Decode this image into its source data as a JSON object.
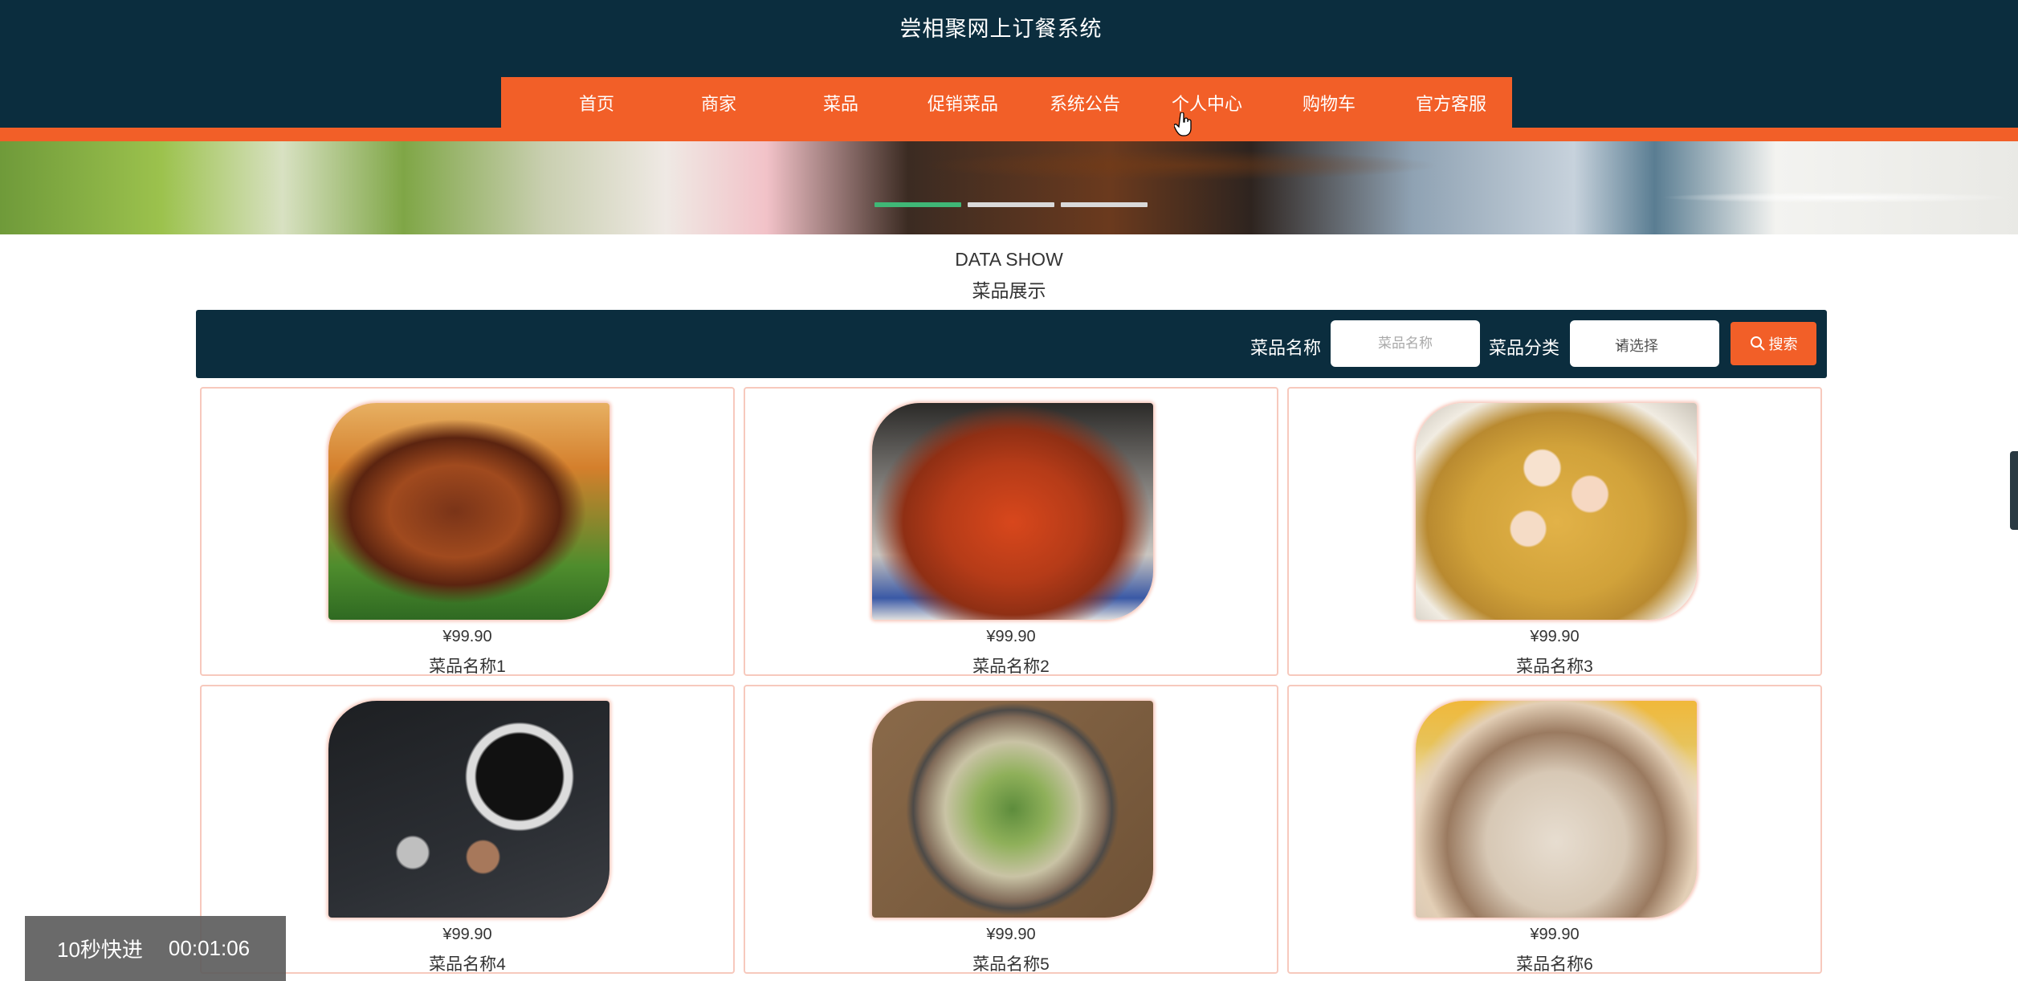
{
  "site": {
    "title": "尝相聚网上订餐系统"
  },
  "nav": {
    "items": [
      "首页",
      "商家",
      "菜品",
      "促销菜品",
      "系统公告",
      "个人中心",
      "购物车",
      "官方客服"
    ]
  },
  "banner": {
    "slide_count": 3,
    "active_slide": 1
  },
  "section": {
    "title_en": "DATA SHOW",
    "title_cn": "菜品展示"
  },
  "search": {
    "name_label": "菜品名称",
    "name_placeholder": "菜品名称",
    "category_label": "菜品分类",
    "category_selected": "请选择",
    "button_label": "搜索"
  },
  "dishes": [
    {
      "price": "¥99.90",
      "name": "菜品名称1"
    },
    {
      "price": "¥99.90",
      "name": "菜品名称2"
    },
    {
      "price": "¥99.90",
      "name": "菜品名称3"
    },
    {
      "price": "¥99.90",
      "name": "菜品名称4"
    },
    {
      "price": "¥99.90",
      "name": "菜品名称5"
    },
    {
      "price": "¥99.90",
      "name": "菜品名称6"
    }
  ],
  "video_overlay": {
    "skip_label": "10秒快进",
    "time": "00:01:06"
  },
  "colors": {
    "header": "#0b2d3e",
    "accent": "#f25f28",
    "active_dot": "#3fb776"
  }
}
